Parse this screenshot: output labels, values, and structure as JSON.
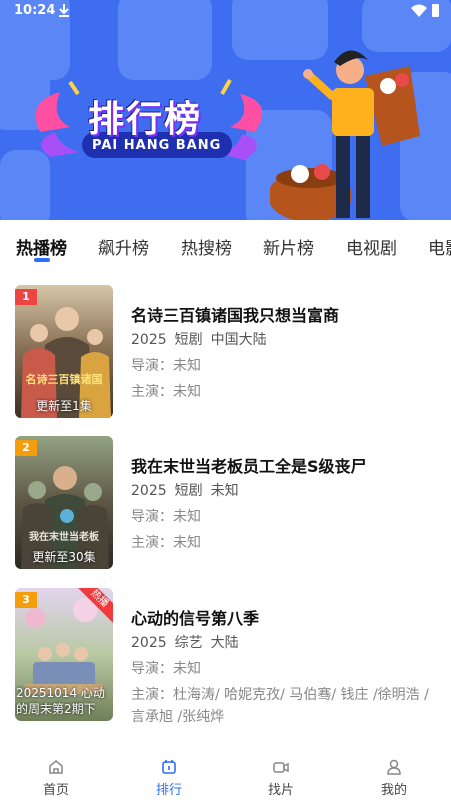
{
  "status": {
    "time": "10:24"
  },
  "banner": {
    "title": "排行榜",
    "subtitle": "PAI HANG BANG"
  },
  "tabs": [
    {
      "label": "热播榜",
      "active": true
    },
    {
      "label": "飙升榜"
    },
    {
      "label": "热搜榜"
    },
    {
      "label": "新片榜"
    },
    {
      "label": "电视剧"
    },
    {
      "label": "电影"
    }
  ],
  "items": [
    {
      "rank": "1",
      "rank_color": "#ef4444",
      "title": "名诗三百镇诸国我只想当富商",
      "year": "2025",
      "genre": "短剧",
      "region": "中国大陆",
      "director": "导演：未知",
      "cast": "主演：未知",
      "update": "更新至1集",
      "poster_colors": [
        "#c9b79a",
        "#6b5a44",
        "#3a2e22"
      ]
    },
    {
      "rank": "2",
      "rank_color": "#f59e0b",
      "title": "我在末世当老板员工全是S级丧尸",
      "year": "2025",
      "genre": "短剧",
      "region": "未知",
      "director": "导演：未知",
      "cast": "主演：未知",
      "update": "更新至30集",
      "poster_colors": [
        "#8a9a7a",
        "#5a5240",
        "#2e2a22"
      ]
    },
    {
      "rank": "3",
      "rank_color": "#f59e0b",
      "title": "心动的信号第八季",
      "year": "2025",
      "genre": "综艺",
      "region": "大陆",
      "director": "导演：未知",
      "cast": "主演：杜海涛/ 哈妮克孜/ 马伯骞/ 钱庄 /徐明浩 /言承旭 /张纯烨",
      "update": "20251014 心动的周末第2期下",
      "hot": "热播",
      "poster_colors": [
        "#d8c7e6",
        "#9db88a",
        "#6a7a54"
      ]
    }
  ],
  "bottom_nav": [
    {
      "label": "首页",
      "icon": "home-icon"
    },
    {
      "label": "排行",
      "icon": "rank-icon",
      "active": true
    },
    {
      "label": "找片",
      "icon": "video-icon"
    },
    {
      "label": "我的",
      "icon": "user-icon"
    }
  ],
  "colors": {
    "accent": "#2d6ef7",
    "banner": "#3f6df0"
  }
}
